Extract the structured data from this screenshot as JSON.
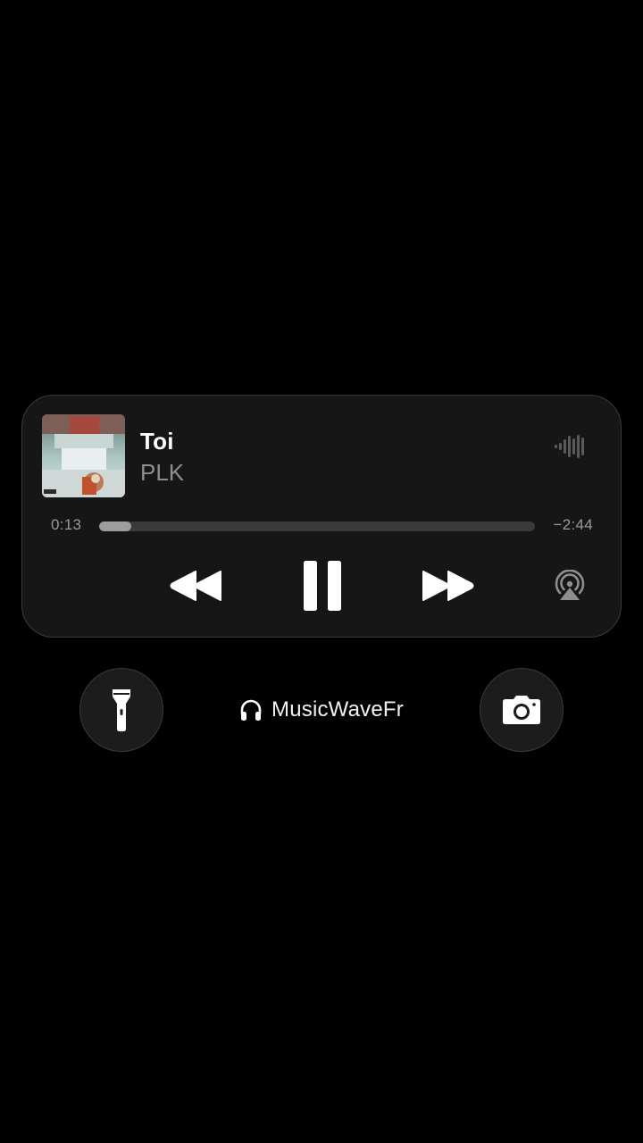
{
  "now_playing": {
    "title": "Toi",
    "artist": "PLK",
    "elapsed": "0:13",
    "remaining": "−2:44",
    "progress_fraction": 0.074,
    "icons": {
      "waveform": "waveform-icon",
      "rewind": "backward-icon",
      "pause": "pause-icon",
      "forward": "forward-icon",
      "airplay": "airplay-icon"
    }
  },
  "quick_actions": {
    "flashlight_icon": "flashlight-icon",
    "camera_icon": "camera-icon"
  },
  "credit": {
    "icon": "headphones-icon",
    "text": "MusicWaveFr"
  },
  "colors": {
    "background": "#000000",
    "card": "#161616",
    "secondary_text": "#8e8e8e",
    "progress_fill": "#9d9d9d",
    "progress_track": "#3a3a3a"
  }
}
